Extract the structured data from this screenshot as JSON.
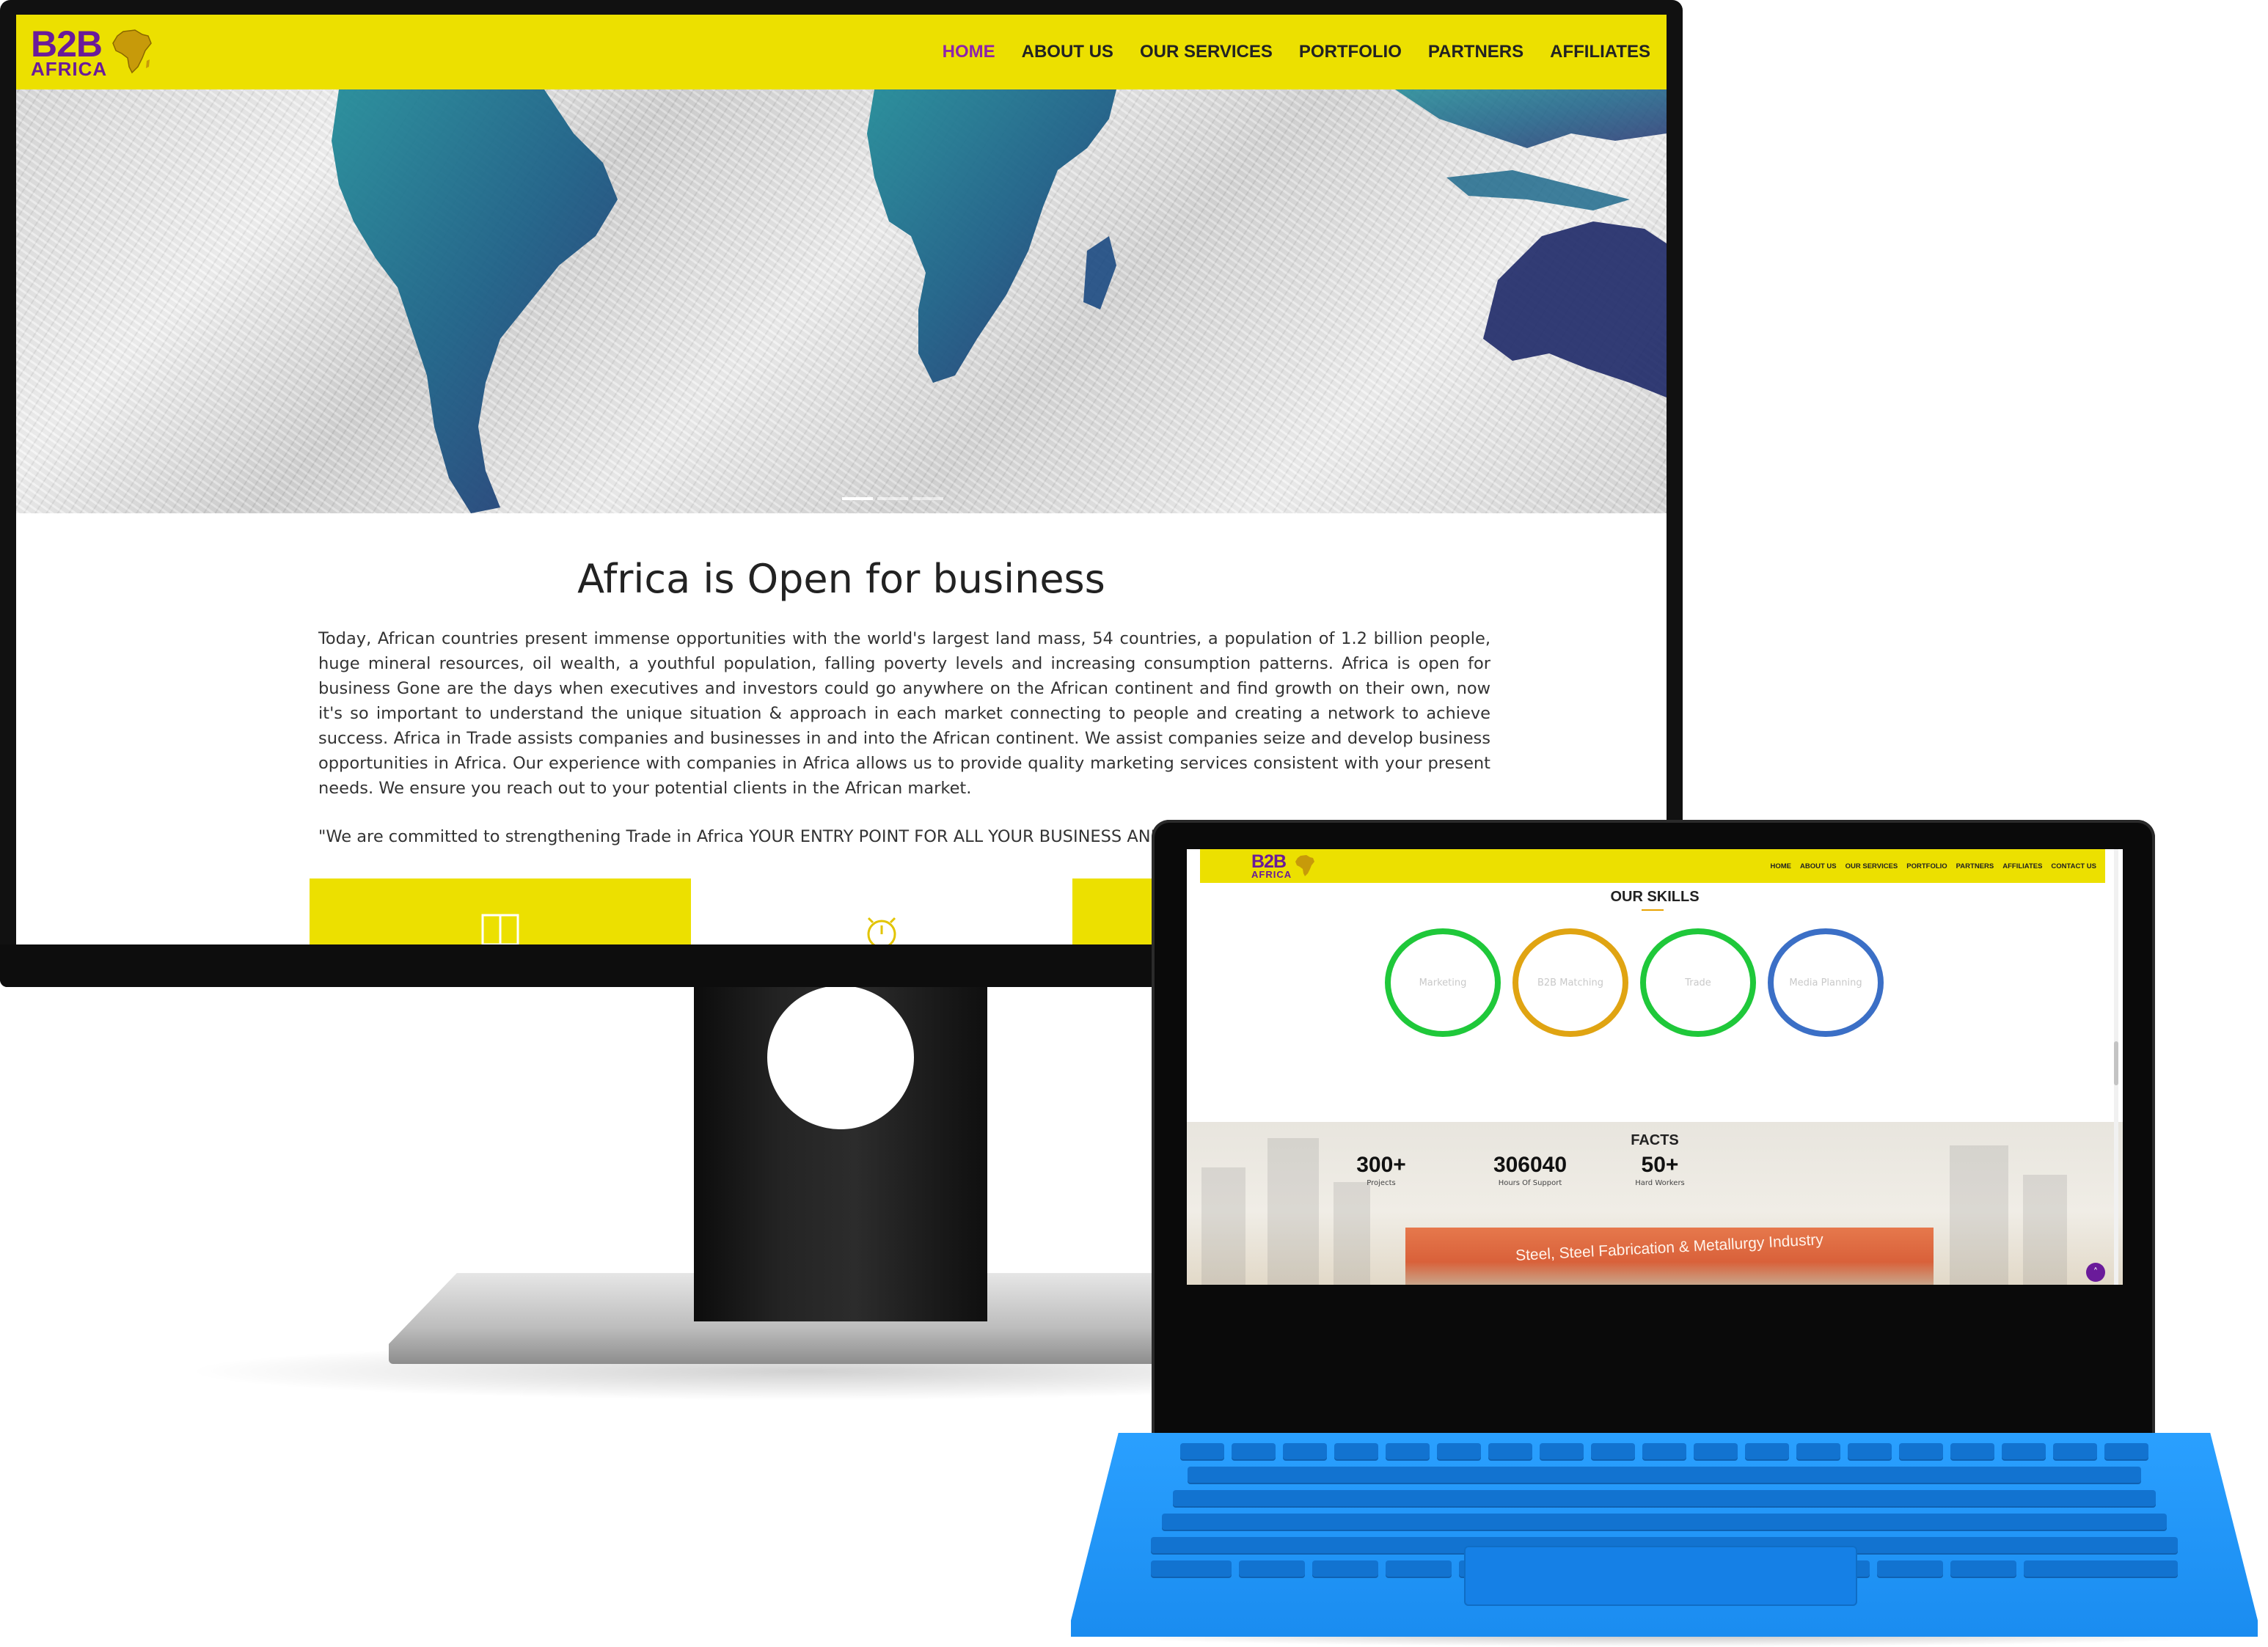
{
  "monitor_site": {
    "logo": {
      "line1": "B2B",
      "line2": "AFRICA"
    },
    "nav": [
      {
        "label": "HOME",
        "active": true
      },
      {
        "label": "ABOUT US"
      },
      {
        "label": "OUR SERVICES"
      },
      {
        "label": "PORTFOLIO"
      },
      {
        "label": "PARTNERS"
      },
      {
        "label": "AFFILIATES"
      }
    ],
    "intro": {
      "title": "Africa is Open for business",
      "body": "Today, African countries present immense opportunities with the world's largest land mass, 54 countries, a population of 1.2 billion people, huge mineral resources, oil wealth, a youthful population, falling poverty levels and increasing consumption patterns. Africa is open for business Gone are the days when executives and investors could go anywhere on the African continent and find growth on their own, now it's so important to understand the unique situation & approach in each market connecting to people and creating a network to achieve success. Africa in Trade assists companies and businesses in and into the African continent. We assist companies seize and develop business opportunities in Africa. Our experience with companies in Africa allows us to provide quality marketing services consistent with your present needs. We ensure you reach out to your potential clients in the African market.",
      "quote": "\"We are committed to strengthening Trade in Africa YOUR ENTRY POINT FOR ALL YOUR BUSINESS AND INVESTM"
    },
    "slider": {
      "count": 3,
      "active_index": 0
    }
  },
  "tablet_site": {
    "logo": {
      "line1": "B2B",
      "line2": "AFRICA"
    },
    "nav": [
      "HOME",
      "ABOUT US",
      "OUR SERVICES",
      "PORTFOLIO",
      "PARTNERS",
      "AFFILIATES",
      "CONTACT US"
    ],
    "skills": {
      "title": "OUR SKILLS",
      "items": [
        {
          "label": "Marketing",
          "color": "#1fc83a"
        },
        {
          "label": "B2B Matching",
          "color": "#e0a412"
        },
        {
          "label": "Trade",
          "color": "#1fc83a"
        },
        {
          "label": "Media Planning",
          "color": "#3b6fc6"
        }
      ]
    },
    "facts": {
      "title": "FACTS",
      "stats": [
        {
          "value": "300+",
          "label": "Projects"
        },
        {
          "value": "306040",
          "label": "Hours Of Support"
        },
        {
          "value": "50+",
          "label": "Hard Workers"
        }
      ],
      "banner_text": "Steel, Steel Fabrication & Metallurgy Industry"
    },
    "back_to_top_icon": "chevron-up-icon"
  },
  "colors": {
    "nav_yellow": "#ece000",
    "brand_purple": "#6a1b9a",
    "active_link": "#8e24aa",
    "keyboard_blue": "#1a8cf0"
  }
}
